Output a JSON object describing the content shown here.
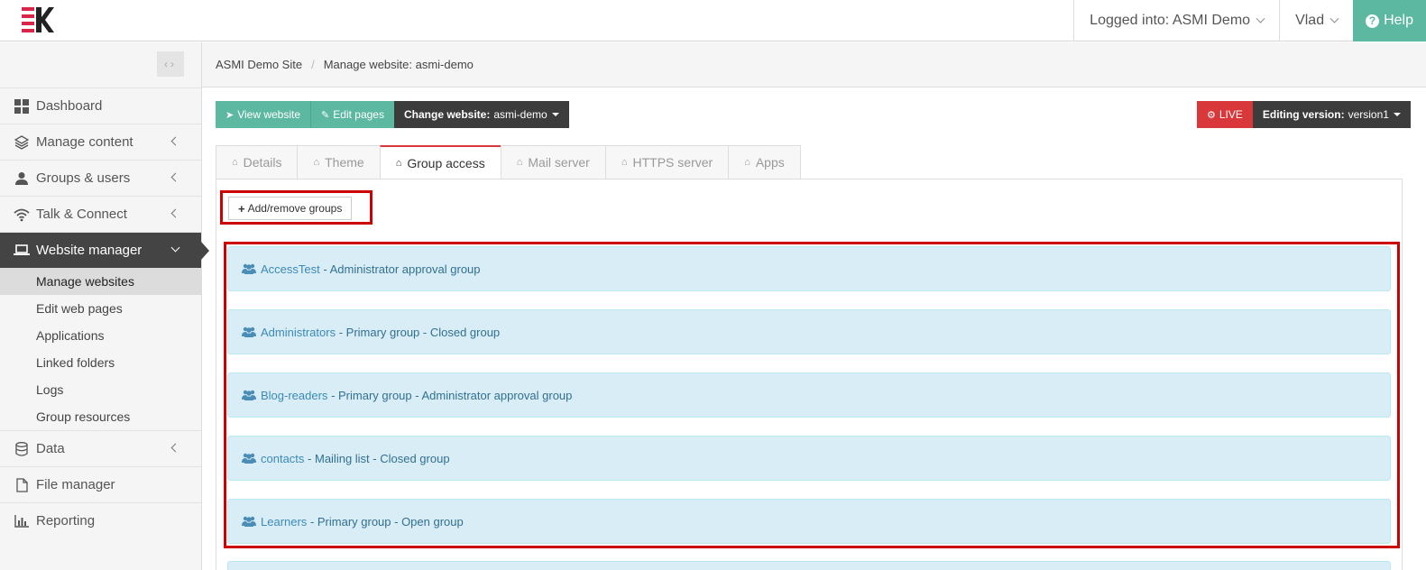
{
  "header": {
    "logged_into": "Logged into: ASMI Demo",
    "user": "Vlad",
    "help": "Help"
  },
  "sidebar": {
    "items": [
      {
        "label": "Dashboard",
        "icon": "dashboard-grid-icon"
      },
      {
        "label": "Manage content",
        "icon": "layers-icon"
      },
      {
        "label": "Groups & users",
        "icon": "user-icon"
      },
      {
        "label": "Talk & Connect",
        "icon": "wifi-icon"
      },
      {
        "label": "Website manager",
        "icon": "laptop-icon"
      },
      {
        "label": "Data",
        "icon": "database-icon"
      },
      {
        "label": "File manager",
        "icon": "file-icon"
      },
      {
        "label": "Reporting",
        "icon": "bar-chart-icon"
      }
    ],
    "submenu": [
      "Manage websites",
      "Edit web pages",
      "Applications",
      "Linked folders",
      "Logs",
      "Group resources"
    ]
  },
  "breadcrumb": {
    "root": "ASMI Demo Site",
    "current": "Manage website: asmi-demo"
  },
  "toolbar": {
    "view_website": "View website",
    "edit_pages": "Edit pages",
    "change_website_label": "Change website:",
    "change_website_value": "asmi-demo",
    "live": "LIVE",
    "editing_version_label": "Editing version:",
    "editing_version_value": "version1"
  },
  "tabs": [
    "Details",
    "Theme",
    "Group access",
    "Mail server",
    "HTTPS server",
    "Apps"
  ],
  "add_remove_groups": "Add/remove groups",
  "groups": [
    {
      "name": "AccessTest",
      "desc": "- Administrator approval group"
    },
    {
      "name": "Administrators",
      "desc": "- Primary group - Closed group"
    },
    {
      "name": "Blog-readers",
      "desc": "- Primary group - Administrator approval group"
    },
    {
      "name": "contacts",
      "desc": "- Mailing list - Closed group"
    },
    {
      "name": "Learners",
      "desc": "- Primary group - Open group"
    }
  ],
  "colors": {
    "accent_teal": "#5cb8a0",
    "live_red": "#d9383a",
    "dark": "#3c3c3c",
    "group_bg": "#d9edf7",
    "highlight_box": "#cc0000"
  }
}
